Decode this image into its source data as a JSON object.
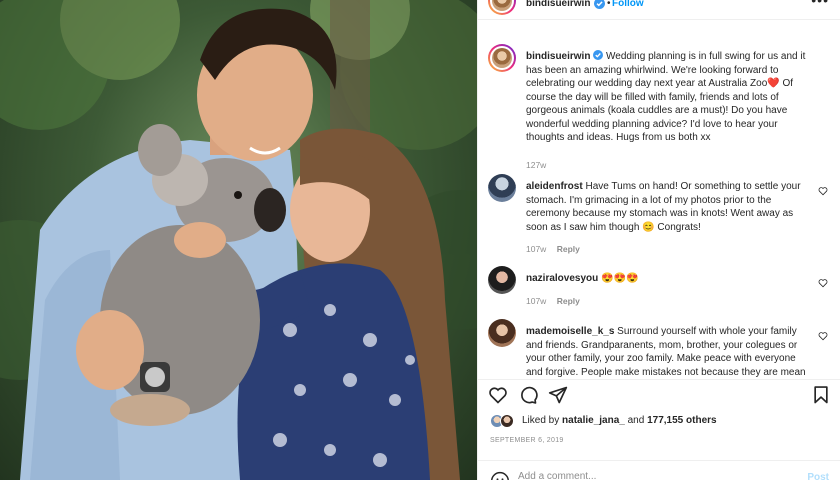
{
  "post": {
    "username": "bindisueirwin",
    "follow_label": "Follow",
    "more_label": "•••",
    "caption": "Wedding planning is in full swing for us and it has been an amazing whirlwind. We're looking forward to celebrating our wedding day next year at Australia Zoo❤️ Of course the day will be filled with family, friends and lots of gorgeous animals (koala cuddles are a must)! Do you have wonderful wedding planning advice? I'd love to hear your thoughts and ideas. Hugs from us both xx",
    "caption_time": "127w"
  },
  "comments": [
    {
      "username": "aleidenfrost",
      "text": "Have Tums on hand! Or something to settle your stomach. I'm grimacing in a lot of my photos prior to the ceremony because my stomach was in knots! Went away as soon as I saw him though 😊 Congrats!",
      "time": "107w",
      "reply_label": "Reply"
    },
    {
      "username": "naziralovesyou",
      "text": "😍😍😍",
      "time": "107w",
      "reply_label": "Reply"
    },
    {
      "username": "mademoiselle_k_s",
      "text": "Surround yourself with whole your family and friends. Grandparanents, mom, brother, your colegues or your other family, your zoo family. Make peace with everyone and forgive. People make mistakes not because they are mean",
      "time": "",
      "reply_label": ""
    }
  ],
  "likes": {
    "prefix": "Liked by",
    "first_user": "natalie_jana_",
    "joiner": "and",
    "others": "177,155 others"
  },
  "date": "SEPTEMBER 6, 2019",
  "add_comment": {
    "placeholder": "Add a comment...",
    "post_label": "Post"
  },
  "icons": {
    "like": "heart-icon",
    "comment": "comment-icon",
    "share": "paper-plane-icon",
    "save": "bookmark-icon",
    "verified": "verified-badge-icon",
    "emoji": "smiley-icon"
  },
  "colors": {
    "link_blue": "#0095f6",
    "verified_blue": "#3897f0",
    "secondary_text": "#8e8e8e",
    "post_disabled": "#b2dffc"
  }
}
